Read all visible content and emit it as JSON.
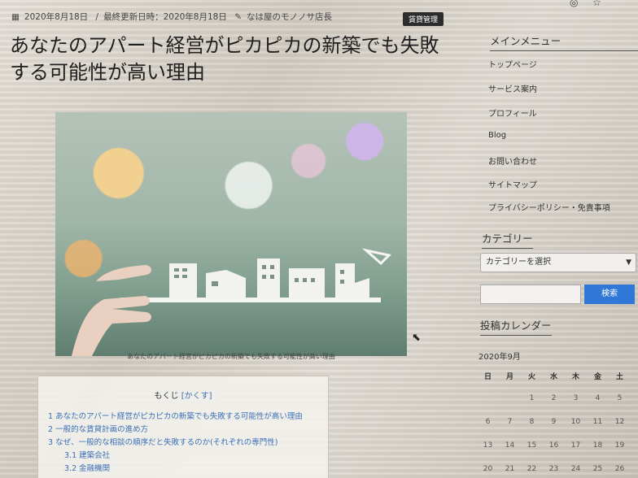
{
  "post": {
    "published": "2020年8月18日",
    "updated": "最終更新日時：2020年8月18日",
    "author": "なは屋のモノノサ店長",
    "category_badge": "賃貸管理",
    "title": "あなたのアパート経営がピカピカの新築でも失敗する可能性が高い理由",
    "image_caption": "あなたのアパート経営がピカピカの新築でも失敗する可能性が高い理由"
  },
  "toc": {
    "heading": "もくじ",
    "toggle": "[かくす]",
    "items": [
      {
        "label": "1 あなたのアパート経営がピカピカの新築でも失敗する可能性が高い理由",
        "level": 1
      },
      {
        "label": "2 一般的な賃貸計画の進め方",
        "level": 1
      },
      {
        "label": "3 なぜ、一般的な相談の順序だと失敗するのか(それぞれの専門性)",
        "level": 1
      },
      {
        "label": "3.1 建築会社",
        "level": 2
      },
      {
        "label": "3.2 金融機関",
        "level": 2
      }
    ]
  },
  "sidebar": {
    "menu_title": "メインメニュー",
    "menu_items": [
      "トップページ",
      "サービス案内",
      "プロフィール",
      "Blog",
      "お問い合わせ",
      "サイトマップ",
      "プライバシーポリシー・免責事項"
    ],
    "category_title": "カテゴリー",
    "category_select": "カテゴリーを選択",
    "search_button": "検索",
    "calendar_title": "投稿カレンダー",
    "calendar_month": "2020年9月",
    "weekdays": [
      "日",
      "月",
      "火",
      "水",
      "木",
      "金",
      "土"
    ],
    "weeks": [
      [
        "",
        "",
        "1",
        "2",
        "3",
        "4",
        "5"
      ],
      [
        "6",
        "7",
        "8",
        "9",
        "10",
        "11",
        "12"
      ],
      [
        "13",
        "14",
        "15",
        "16",
        "17",
        "18",
        "19"
      ],
      [
        "20",
        "21",
        "22",
        "23",
        "24",
        "25",
        "26"
      ]
    ]
  },
  "colors": {
    "link": "#3a6fb5",
    "search_button": "#2f78d8",
    "badge": "#2d2d2d"
  }
}
